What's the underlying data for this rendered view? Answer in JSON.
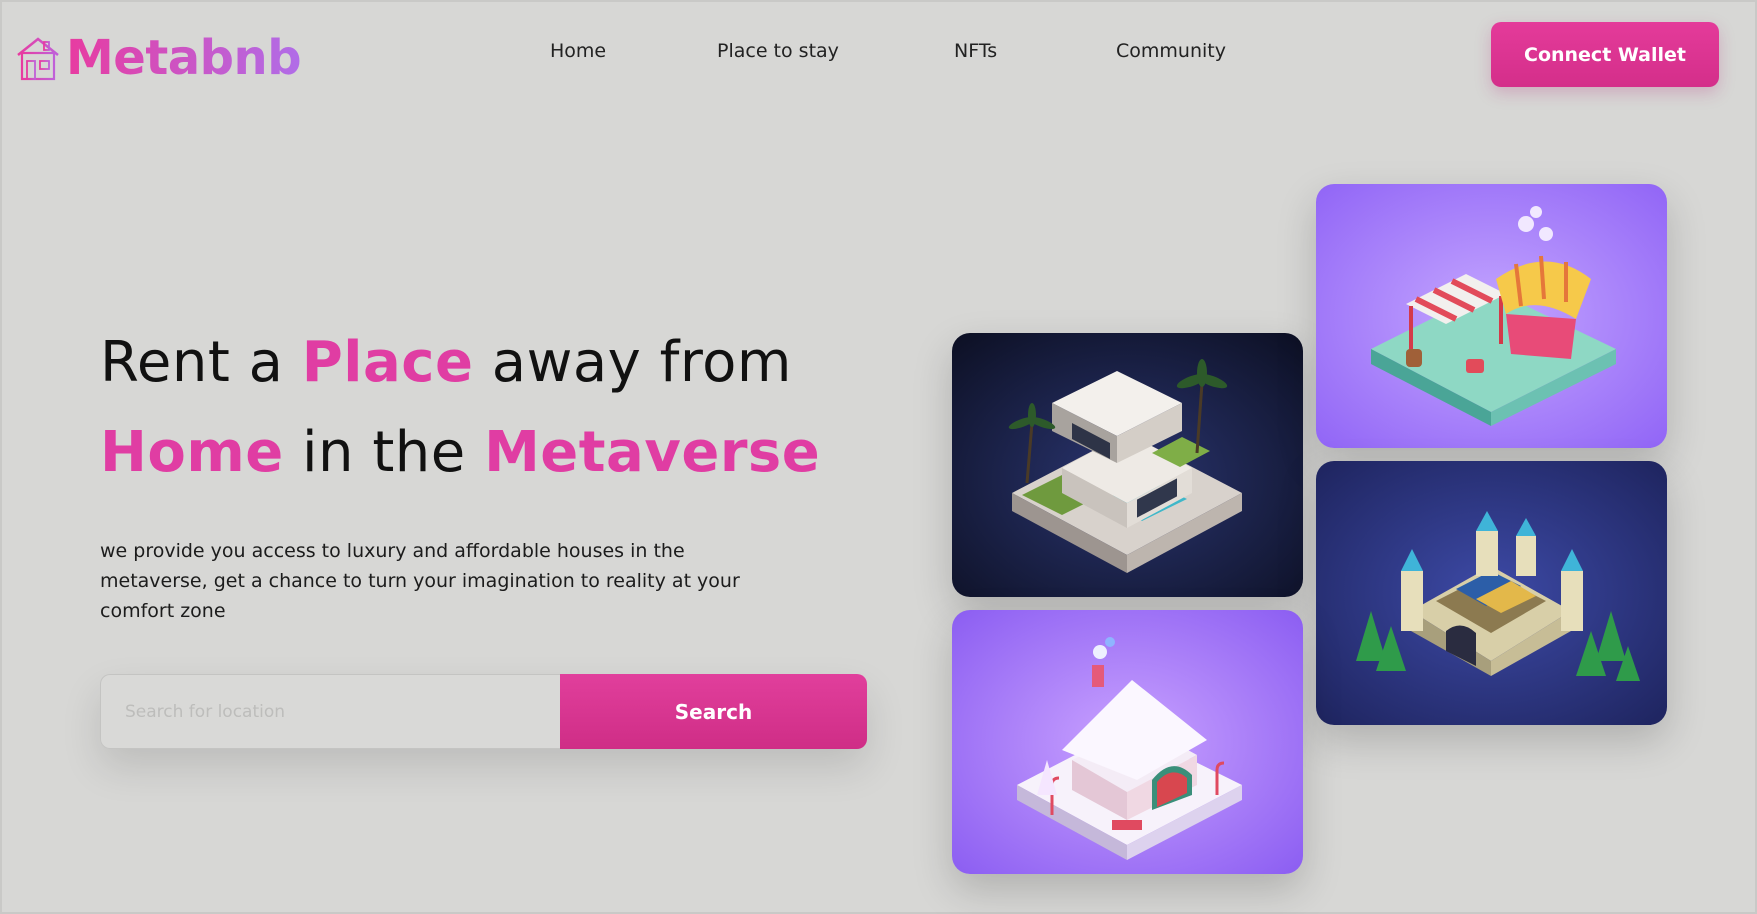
{
  "brand": {
    "name": "Metabnb",
    "icon": "house-icon",
    "colors": {
      "primary": "#e03da3",
      "gradient_end": "#b06de8"
    }
  },
  "nav": {
    "items": [
      {
        "label": "Home"
      },
      {
        "label": "Place to stay"
      },
      {
        "label": "NFTs"
      },
      {
        "label": "Community"
      }
    ],
    "cta_label": "Connect Wallet"
  },
  "hero": {
    "title": {
      "w1": "Rent a",
      "w2": "Place",
      "w3": "away from",
      "w4": "Home",
      "w5": "in the",
      "w6": "Metaverse"
    },
    "description": "we provide you access to luxury and affordable houses in the metaverse, get a chance to turn your imagination to reality at your comfort zone",
    "search": {
      "placeholder": "Search for location",
      "button_label": "Search"
    }
  },
  "gallery": {
    "images": [
      {
        "subject": "isometric-modern-villa-image"
      },
      {
        "subject": "isometric-market-stalls-image"
      },
      {
        "subject": "isometric-castle-image"
      },
      {
        "subject": "isometric-gingerbread-house-image"
      }
    ]
  }
}
